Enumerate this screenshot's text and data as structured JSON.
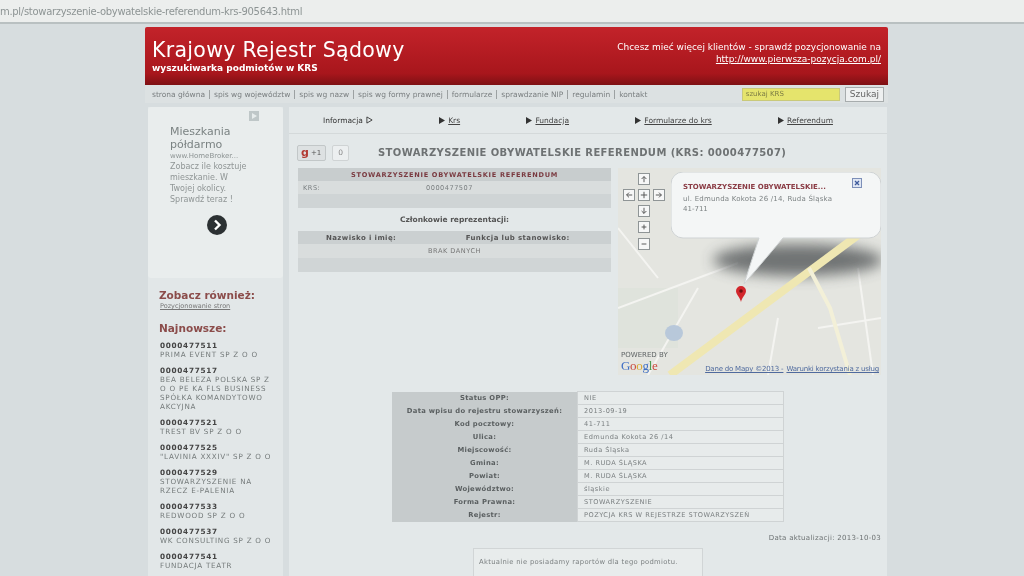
{
  "address_bar": {
    "url": "m.pl/stowarzyszenie-obywatelskie-referendum-krs-905643.html"
  },
  "header": {
    "title": "Krajowy Rejestr Sądowy",
    "subtitle": "wyszukiwarka podmiotów w KRS",
    "promo_text": "Chcesz mieć więcej klientów - sprawdź pozycjonowanie na",
    "promo_link": "http://www.pierwsza-pozycja.com.pl/"
  },
  "nav": {
    "links": [
      "strona główna",
      "spis wg województw",
      "spis wg nazw",
      "spis wg formy prawnej",
      "formularze",
      "sprawdzanie NIP",
      "regulamin",
      "kontakt"
    ],
    "search": {
      "placeholder": "szukaj KRS"
    },
    "search_button": "Szukaj"
  },
  "sidebar": {
    "ad": {
      "title": "Mieszkania półdarmo",
      "url": "www.HomeBroker...",
      "text": "Zobacz ile kosztuje mieszkanie. W Twojej okolicy. Sprawdź teraz !"
    },
    "see_also": {
      "heading": "Zobacz również:",
      "link": "Pozycjonowanie stron"
    },
    "newest": {
      "heading": "Najnowsze:",
      "items": [
        {
          "krs": "0000477511",
          "name": "PRIMA EVENT SP Z O O"
        },
        {
          "krs": "0000477517",
          "name": "BEA BELEZA POLSKA SP Z O O PE KA FLS BUSINESS SPÓŁKA KOMANDYTOWO AKCYJNA"
        },
        {
          "krs": "0000477521",
          "name": "TREST BV SP Z O O"
        },
        {
          "krs": "0000477525",
          "name": "\"LAVINIA XXXIV\" SP Z O O"
        },
        {
          "krs": "0000477529",
          "name": "STOWARZYSZENIE NA RZECZ E-PALENIA"
        },
        {
          "krs": "0000477533",
          "name": "REDWOOD SP Z O O"
        },
        {
          "krs": "0000477537",
          "name": "WK CONSULTING SP Z O O"
        },
        {
          "krs": "0000477541",
          "name": "FUNDACJA TEATR"
        }
      ]
    }
  },
  "tabs": [
    {
      "label": "Informacja",
      "selected": true
    },
    {
      "label": "Krs",
      "selected": false
    },
    {
      "label": "Fundacja",
      "selected": false
    },
    {
      "label": "Formularze do krs",
      "selected": false
    },
    {
      "label": "Referendum",
      "selected": false
    }
  ],
  "plus_one": {
    "logo": "g",
    "label": "+1",
    "count": "0"
  },
  "title": "STOWARZYSZENIE OBYWATELSKIE REFERENDUM (KRS: 0000477507)",
  "entity_table": {
    "heading": "STOWARZYSZENIE OBYWATELSKIE REFERENDUM",
    "rows": [
      {
        "label": "KRS:",
        "value": "0000477507"
      }
    ]
  },
  "representation": {
    "heading": "Członkowie reprezentacji:",
    "columns": [
      "Nazwisko i imię:",
      "Funkcja lub stanowisko:"
    ],
    "empty_text": "BRAK DANYCH"
  },
  "map": {
    "popup": {
      "title": "STOWARZYSZENIE OBYWATELSKIE...",
      "address": "ul. Edmunda Kokota 26 /14, Ruda Śląska",
      "postcode": "41-711"
    },
    "powered_by": "POWERED BY",
    "logo": "Google",
    "attribution": "Dane do Mapy ©2013 -",
    "terms_link": "Warunki korzystania z usług"
  },
  "details": [
    {
      "label": "Status OPP:",
      "value": "NIE"
    },
    {
      "label": "Data wpisu do rejestru stowarzyszeń:",
      "value": "2013-09-19"
    },
    {
      "label": "Kod pocztowy:",
      "value": "41-711"
    },
    {
      "label": "Ulica:",
      "value": "Edmunda Kokota 26 /14"
    },
    {
      "label": "Miejscowość:",
      "value": "Ruda Śląska"
    },
    {
      "label": "Gmina:",
      "value": "M. RUDA ŚLĄSKA"
    },
    {
      "label": "Powiat:",
      "value": "M. RUDA ŚLĄSKA"
    },
    {
      "label": "Województwo:",
      "value": "śląskie"
    },
    {
      "label": "Forma Prawna:",
      "value": "STOWARZYSZENIE"
    },
    {
      "label": "Rejestr:",
      "value": "POZYCJA KRS W REJESTRZE STOWARZYSZEŃ"
    }
  ],
  "updated": "Data aktualizacji: 2013-10-03",
  "reports_note": "Aktualnie nie posiadamy raportów dla tego podmiotu."
}
